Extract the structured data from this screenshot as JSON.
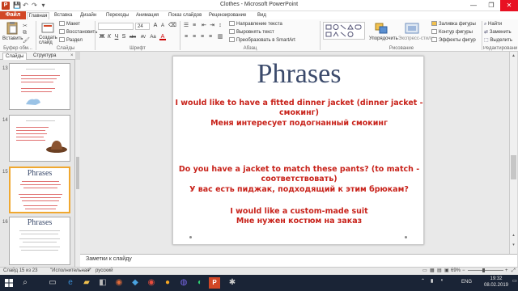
{
  "window": {
    "title": "Clothes - Microsoft PowerPoint",
    "app_icon_label": "P",
    "minimize": "—",
    "maximize": "❐",
    "close": "✕"
  },
  "quick_access": [
    "💾",
    "↶",
    "↷",
    "▾"
  ],
  "ribbon_tabs": {
    "file": "Файл",
    "items": [
      "Главная",
      "Вставка",
      "Дизайн",
      "Переходы",
      "Анимация",
      "Показ слайдов",
      "Рецензирование",
      "Вид"
    ]
  },
  "ribbon": {
    "clipboard": {
      "paste": "Вставить",
      "group": "Буфер обм..."
    },
    "slides": {
      "new_slide": "Создать слайд",
      "layout": "Макет",
      "reset": "Восстановить",
      "section": "Раздел",
      "group": "Слайды"
    },
    "font": {
      "size": "24",
      "group": "Шрифт",
      "name_placeholder": "",
      "format_buttons": [
        "Ж",
        "К",
        "Ч",
        "S",
        "abc",
        "AV",
        "Aa",
        "A"
      ]
    },
    "paragraph": {
      "text_direction": "Направление текста",
      "align_text": "Выровнять текст",
      "smartart": "Преобразовать в SmartArt",
      "group": "Абзац"
    },
    "drawing": {
      "arrange": "Упорядочить",
      "quick_styles": "Экспресс-стили",
      "shape_fill": "Заливка фигуры",
      "shape_outline": "Контур фигуры",
      "shape_effects": "Эффекты фигур",
      "group": "Рисование"
    },
    "editing": {
      "find": "Найти",
      "replace": "Заменить",
      "select": "Выделить",
      "group": "Редактирование"
    }
  },
  "left_pane": {
    "tab_slides": "Слайды",
    "tab_outline": "Структура",
    "close": "×",
    "thumbnails": [
      {
        "number": "13"
      },
      {
        "number": "14"
      },
      {
        "number": "15",
        "title": "Phrases",
        "selected": true
      },
      {
        "number": "16",
        "title": "Phrases"
      }
    ]
  },
  "slide": {
    "title": "Phrases",
    "paragraphs": [
      "I would like to have a fitted dinner jacket  (dinner jacket - смокинг)",
      "Меня интересует подогнанный смокинг",
      "Do you have a jacket to match these pants?  (to match - соответствовать)",
      "У вас есть пиджак, подходящий к этим брюкам?",
      "I would like a custom-made suit",
      "Мне нужен костюм на заказ"
    ]
  },
  "notes": {
    "placeholder": "Заметки к слайду"
  },
  "status_bar": {
    "slide_counter": "Слайд 15 из 23",
    "theme": "\"Исполнительная\"",
    "language": "русский",
    "zoom": "69%"
  },
  "taskbar": {
    "language": "ENG",
    "time": "19:32",
    "date": "08.02.2019"
  },
  "colors": {
    "accent": "#d24726",
    "slide_text": "#c8221a",
    "title_text": "#3b4a6b",
    "selection": "#f0a830"
  }
}
